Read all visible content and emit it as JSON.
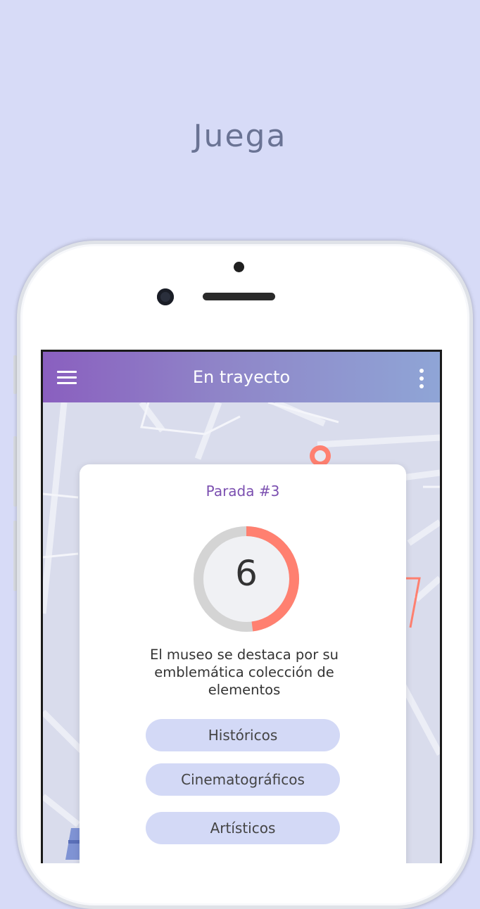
{
  "headline": "Juega",
  "app": {
    "title": "En trayecto",
    "menu_icon": "menu-icon",
    "more_icon": "more-vert-icon",
    "accent_colors": {
      "appbar_start": "#8a5fbf",
      "appbar_end": "#8fa5d6",
      "timer_fill": "#ff8070",
      "timer_track": "#d4d4d4",
      "answer_bg": "#d3d9f6"
    }
  },
  "card": {
    "stop_title": "Parada #3",
    "timer_value": "6",
    "timer_progress": 0.48,
    "question": "El museo se destaca por su emblemática colección de elementos",
    "answers": [
      {
        "label": "Históricos"
      },
      {
        "label": "Cinematográficos"
      },
      {
        "label": "Artísticos"
      }
    ]
  }
}
